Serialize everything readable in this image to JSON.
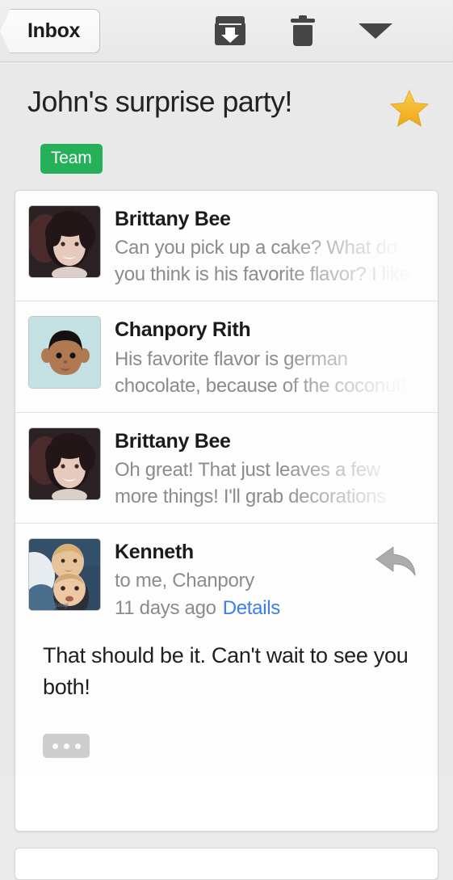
{
  "toolbar": {
    "back_label": "Inbox",
    "archive_icon": "archive-icon",
    "delete_icon": "trash-icon",
    "more_icon": "chevron-down-icon"
  },
  "header": {
    "subject": "John's surprise party!",
    "starred": true,
    "star_icon": "star-icon",
    "labels": [
      {
        "text": "Team",
        "color": "#24b159"
      }
    ]
  },
  "colors": {
    "label_green": "#24b159",
    "star_gold": "#f4b728",
    "link_blue": "#3b7ef2",
    "page_bg": "#ebebeb",
    "card_bg": "#ffffff",
    "snippet_gray": "#8c8c8c"
  },
  "thread": {
    "messages": [
      {
        "sender": "Brittany Bee",
        "snippet": "Can you pick up a cake? What do you think is his favorite flavor? I like",
        "avatar": "photo-woman",
        "expanded": false
      },
      {
        "sender": "Chanpory Rith",
        "snippet": "His favorite flavor is german chocolate, because of the coconut!",
        "avatar": "illustration-man",
        "expanded": false
      },
      {
        "sender": "Brittany Bee",
        "snippet": "Oh great! That just leaves a few more things! I'll grab decorations",
        "avatar": "photo-woman",
        "expanded": false
      }
    ],
    "open_message": {
      "sender": "Kenneth",
      "recipients": "to me, Chanpory",
      "timestamp": "11 days ago",
      "details_label": "Details",
      "reply_icon": "reply-arrow-icon",
      "body": "That should be it. Can't wait to see you both!",
      "quoted_toggle_icon": "ellipsis-icon",
      "avatar": "photo-children"
    }
  }
}
